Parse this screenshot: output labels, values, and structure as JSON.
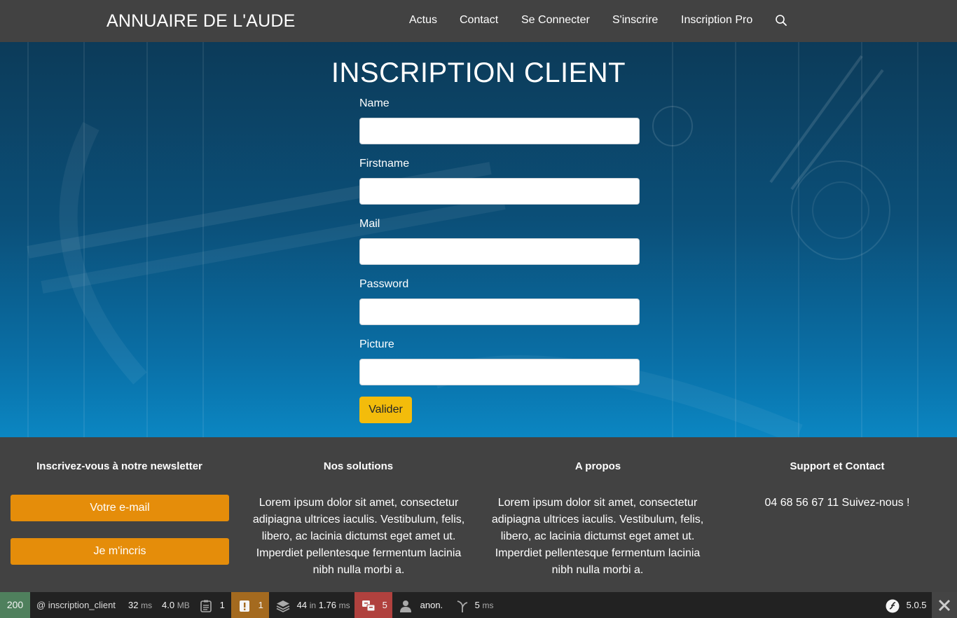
{
  "header": {
    "brand": "ANNUAIRE DE L'AUDE",
    "nav": [
      "Actus",
      "Contact",
      "Se Connecter",
      "S'inscrire",
      "Inscription Pro"
    ],
    "search_icon": "search-icon"
  },
  "form": {
    "title": "INSCRIPTION CLIENT",
    "fields": [
      {
        "label": "Name",
        "value": ""
      },
      {
        "label": "Firstname",
        "value": ""
      },
      {
        "label": "Mail",
        "value": ""
      },
      {
        "label": "Password",
        "value": ""
      },
      {
        "label": "Picture",
        "value": ""
      }
    ],
    "submit": "Valider"
  },
  "footer": {
    "newsletter": {
      "title": "Inscrivez-vous à notre newsletter",
      "email_button": "Votre e-mail",
      "subscribe_button": "Je m'incris"
    },
    "solutions": {
      "title": "Nos solutions",
      "text": "Lorem ipsum dolor sit amet, consectetur adipiagna ultrices iaculis. Vestibulum, felis, libero, ac lacinia dictumst eget amet ut. Imperdiet pellentesque fermentum lacinia nibh nulla morbi a."
    },
    "about": {
      "title": "A propos",
      "text": "Lorem ipsum dolor sit amet, consectetur adipiagna ultrices iaculis. Vestibulum, felis, libero, ac lacinia dictumst eget amet ut. Imperdiet pellentesque fermentum lacinia nibh nulla morbi a."
    },
    "support": {
      "title": "Support et Contact",
      "text": "04 68 56 67 11 Suivez-nous !"
    }
  },
  "toolbar": {
    "status": "200",
    "route": "@ inscription_client",
    "time_value": "32",
    "time_unit": "ms",
    "memory_value": "4.0",
    "memory_unit": "MB",
    "logs": "1",
    "warnings": "1",
    "db_queries": "44",
    "db_in": "in",
    "db_time": "1.76",
    "db_unit": "ms",
    "translations": "5",
    "user": "anon.",
    "twig_time": "5",
    "twig_unit": "ms",
    "symfony_version": "5.0.5",
    "colors": {
      "status_ok": "#4f805d",
      "warning": "#a46a1f",
      "error": "#b0413e"
    }
  }
}
